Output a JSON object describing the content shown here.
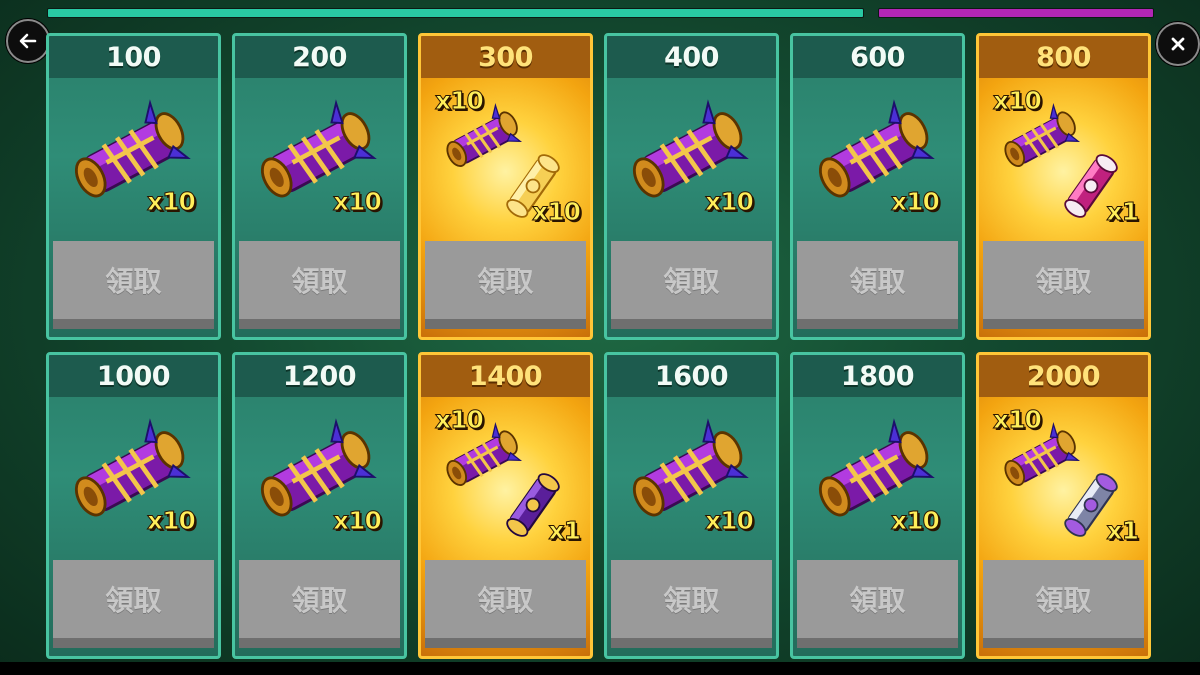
{
  "top_bars": {
    "left_progress": 1.0,
    "left_color": "#29c9a3",
    "right_progress": 1.0,
    "right_color": "#b226b5"
  },
  "nav": {
    "back_icon": "arrow-left-icon",
    "close_icon": "close-icon"
  },
  "colors": {
    "green_card": "#2f8d77",
    "gold_card": "#ffc637",
    "claim_button": "#9a9a9a"
  },
  "rewards": [
    {
      "threshold": "100",
      "style": "green",
      "items": [
        {
          "icon": "purple-scroll-icon",
          "qty": "x10"
        }
      ],
      "claim_label": "領取"
    },
    {
      "threshold": "200",
      "style": "green",
      "items": [
        {
          "icon": "purple-scroll-icon",
          "qty": "x10"
        }
      ],
      "claim_label": "領取"
    },
    {
      "threshold": "300",
      "style": "gold",
      "items": [
        {
          "icon": "purple-scroll-icon",
          "qty": "x10"
        },
        {
          "icon": "golden-scroll-icon",
          "qty": "x10"
        }
      ],
      "claim_label": "領取"
    },
    {
      "threshold": "400",
      "style": "green",
      "items": [
        {
          "icon": "purple-scroll-icon",
          "qty": "x10"
        }
      ],
      "claim_label": "領取"
    },
    {
      "threshold": "600",
      "style": "green",
      "items": [
        {
          "icon": "purple-scroll-icon",
          "qty": "x10"
        }
      ],
      "claim_label": "領取"
    },
    {
      "threshold": "800",
      "style": "gold",
      "items": [
        {
          "icon": "purple-scroll-icon",
          "qty": "x10"
        },
        {
          "icon": "pink-scroll-icon",
          "qty": "x1"
        }
      ],
      "claim_label": "領取"
    },
    {
      "threshold": "1000",
      "style": "green",
      "items": [
        {
          "icon": "purple-scroll-icon",
          "qty": "x10"
        }
      ],
      "claim_label": "領取"
    },
    {
      "threshold": "1200",
      "style": "green",
      "items": [
        {
          "icon": "purple-scroll-icon",
          "qty": "x10"
        }
      ],
      "claim_label": "領取"
    },
    {
      "threshold": "1400",
      "style": "gold",
      "items": [
        {
          "icon": "purple-scroll-icon",
          "qty": "x10"
        },
        {
          "icon": "violet-scroll-icon",
          "qty": "x1"
        }
      ],
      "claim_label": "領取"
    },
    {
      "threshold": "1600",
      "style": "green",
      "items": [
        {
          "icon": "purple-scroll-icon",
          "qty": "x10"
        }
      ],
      "claim_label": "領取"
    },
    {
      "threshold": "1800",
      "style": "green",
      "items": [
        {
          "icon": "purple-scroll-icon",
          "qty": "x10"
        }
      ],
      "claim_label": "領取"
    },
    {
      "threshold": "2000",
      "style": "gold",
      "items": [
        {
          "icon": "purple-scroll-icon",
          "qty": "x10"
        },
        {
          "icon": "silver-scroll-icon",
          "qty": "x1"
        }
      ],
      "claim_label": "領取"
    }
  ]
}
